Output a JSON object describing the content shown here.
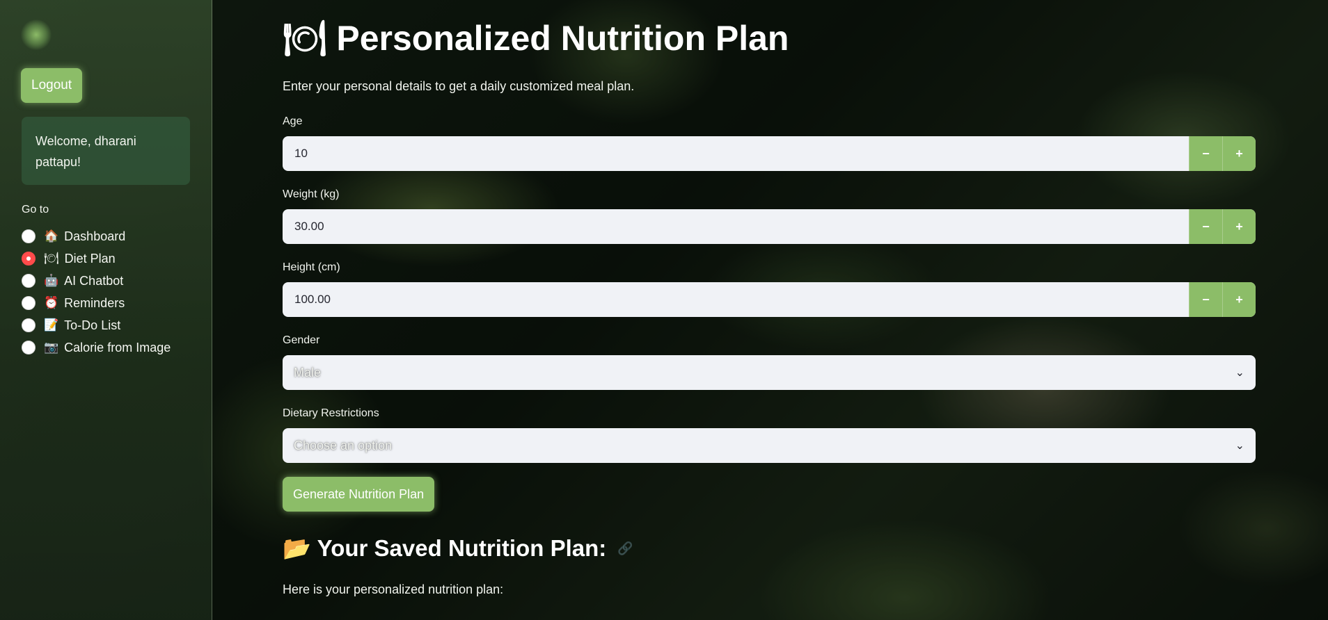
{
  "sidebar": {
    "logout_label": "Logout",
    "welcome_text": "Welcome, dharani pattapu!",
    "goto_label": "Go to",
    "items": [
      {
        "emoji": "🏠",
        "label": "Dashboard",
        "selected": false
      },
      {
        "emoji": "🍽",
        "label": "Diet Plan",
        "selected": true
      },
      {
        "emoji": "🤖",
        "label": "AI Chatbot",
        "selected": false
      },
      {
        "emoji": "⏰",
        "label": "Reminders",
        "selected": false
      },
      {
        "emoji": "📝",
        "label": "To-Do List",
        "selected": false
      },
      {
        "emoji": "📷",
        "label": "Calorie from Image",
        "selected": false
      }
    ]
  },
  "main": {
    "title": "🍽 Personalized Nutrition Plan",
    "subtitle": "Enter your personal details to get a daily customized meal plan.",
    "fields": {
      "age": {
        "label": "Age",
        "value": "10"
      },
      "weight": {
        "label": "Weight (kg)",
        "value": "30.00"
      },
      "height": {
        "label": "Height (cm)",
        "value": "100.00"
      },
      "gender": {
        "label": "Gender",
        "value": "Male"
      },
      "dietary": {
        "label": "Dietary Restrictions",
        "placeholder": "Choose an option"
      }
    },
    "stepper": {
      "minus": "−",
      "plus": "+"
    },
    "chevron": "⌄",
    "generate_label": "Generate Nutrition Plan",
    "saved_heading": "📂 Your Saved Nutrition Plan:",
    "link_glyph": "🔗",
    "saved_text": "Here is your personalized nutrition plan:"
  },
  "colors": {
    "accent": "#8cbd68",
    "radio_selected": "#ff4b4b",
    "input_bg": "#f0f2f6"
  }
}
